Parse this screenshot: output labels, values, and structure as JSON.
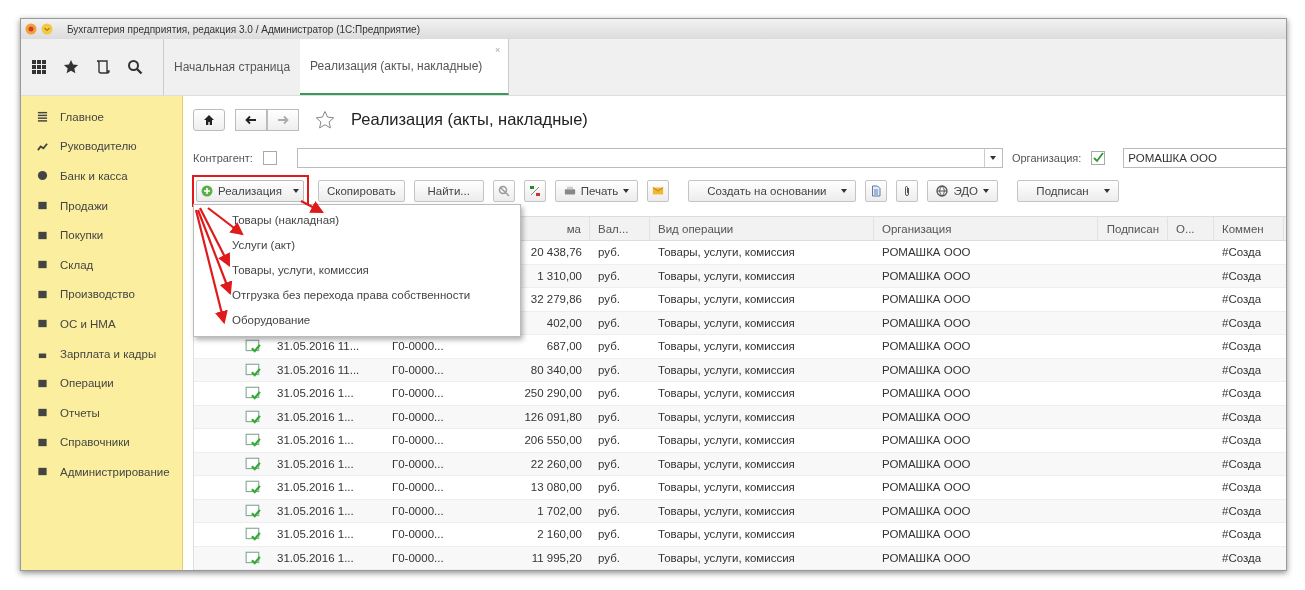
{
  "window": {
    "title": "Бухгалтерия предприятия, редакция 3.0 / Администратор  (1С:Предприятие)"
  },
  "tabs": [
    {
      "label": "Начальная страница",
      "selected": false,
      "closable": false
    },
    {
      "label": "Реализация (акты, накладные)",
      "selected": true,
      "closable": true
    }
  ],
  "tab_close": "×",
  "sidebar": {
    "items": [
      {
        "label": "Главное"
      },
      {
        "label": "Руководителю"
      },
      {
        "label": "Банк и касса"
      },
      {
        "label": "Продажи"
      },
      {
        "label": "Покупки"
      },
      {
        "label": "Склад"
      },
      {
        "label": "Производство"
      },
      {
        "label": "ОС и НМА"
      },
      {
        "label": "Зарплата и кадры"
      },
      {
        "label": "Операции"
      },
      {
        "label": "Отчеты"
      },
      {
        "label": "Справочники"
      },
      {
        "label": "Администрирование"
      }
    ]
  },
  "page": {
    "title": "Реализация (акты, накладные)",
    "favorite": false
  },
  "filters": {
    "counterparty": {
      "label": "Контрагент:",
      "checked": false
    },
    "organization": {
      "label": "Организация:",
      "checked": true,
      "value": "РОМАШКА ООО"
    }
  },
  "toolbar": [
    {
      "kind": "create",
      "label": "Реализация",
      "dropdown": true
    },
    {
      "kind": "text",
      "label": "Скопировать"
    },
    {
      "kind": "text",
      "label": "Найти..."
    },
    {
      "kind": "unfind"
    },
    {
      "kind": "ledger"
    },
    {
      "kind": "print",
      "label": "Печать",
      "dropdown": true
    },
    {
      "kind": "mail"
    },
    {
      "kind": "text",
      "label": "Создать на основании",
      "dropdown": true
    },
    {
      "kind": "report"
    },
    {
      "kind": "attach"
    },
    {
      "kind": "edo",
      "label": "ЭДО",
      "dropdown": true
    },
    {
      "kind": "text",
      "label": "Подписан",
      "dropdown": true
    }
  ],
  "create_menu": {
    "items": [
      "Товары (накладная)",
      "Услуги (акт)",
      "Товары, услуги, комиссия",
      "Отгрузка без перехода права собственности",
      "Оборудование"
    ]
  },
  "table": {
    "columns": [
      {
        "label": "ма"
      },
      {
        "label": "Вал..."
      },
      {
        "label": "Вид операции"
      },
      {
        "label": "Организация"
      },
      {
        "label": "Подписан"
      },
      {
        "label": "О..."
      },
      {
        "label": "Коммен"
      }
    ],
    "rows": [
      {
        "sum": "20 438,76",
        "currency": "руб.",
        "operation": "Товары, услуги, комиссия",
        "organization": "РОМАШКА ООО",
        "comment": "#Созда"
      },
      {
        "sum": "1 310,00",
        "currency": "руб.",
        "operation": "Товары, услуги, комиссия",
        "organization": "РОМАШКА ООО",
        "comment": "#Созда"
      },
      {
        "sum": "32 279,86",
        "currency": "руб.",
        "operation": "Товары, услуги, комиссия",
        "organization": "РОМАШКА ООО",
        "comment": "#Созда"
      },
      {
        "sum": "402,00",
        "currency": "руб.",
        "operation": "Товары, услуги, комиссия",
        "organization": "РОМАШКА ООО",
        "comment": "#Созда"
      },
      {
        "date": "31.05.2016 11...",
        "number": "Г0-0000...",
        "sum": "687,00",
        "currency": "руб.",
        "operation": "Товары, услуги, комиссия",
        "organization": "РОМАШКА ООО",
        "comment": "#Созда"
      },
      {
        "date": "31.05.2016 11...",
        "number": "Г0-0000...",
        "sum": "80 340,00",
        "currency": "руб.",
        "operation": "Товары, услуги, комиссия",
        "organization": "РОМАШКА ООО",
        "comment": "#Созда"
      },
      {
        "date": "31.05.2016 1...",
        "number": "Г0-0000...",
        "sum": "250 290,00",
        "currency": "руб.",
        "operation": "Товары, услуги, комиссия",
        "organization": "РОМАШКА ООО",
        "comment": "#Созда"
      },
      {
        "date": "31.05.2016 1...",
        "number": "Г0-0000...",
        "sum": "126 091,80",
        "currency": "руб.",
        "operation": "Товары, услуги, комиссия",
        "organization": "РОМАШКА ООО",
        "comment": "#Созда"
      },
      {
        "date": "31.05.2016 1...",
        "number": "Г0-0000...",
        "sum": "206 550,00",
        "currency": "руб.",
        "operation": "Товары, услуги, комиссия",
        "organization": "РОМАШКА ООО",
        "comment": "#Созда"
      },
      {
        "date": "31.05.2016 1...",
        "number": "Г0-0000...",
        "sum": "22 260,00",
        "currency": "руб.",
        "operation": "Товары, услуги, комиссия",
        "organization": "РОМАШКА ООО",
        "comment": "#Созда"
      },
      {
        "date": "31.05.2016 1...",
        "number": "Г0-0000...",
        "sum": "13 080,00",
        "currency": "руб.",
        "operation": "Товары, услуги, комиссия",
        "organization": "РОМАШКА ООО",
        "comment": "#Созда"
      },
      {
        "date": "31.05.2016 1...",
        "number": "Г0-0000...",
        "sum": "1 702,00",
        "currency": "руб.",
        "operation": "Товары, услуги, комиссия",
        "organization": "РОМАШКА ООО",
        "comment": "#Созда"
      },
      {
        "date": "31.05.2016 1...",
        "number": "Г0-0000...",
        "sum": "2 160,00",
        "currency": "руб.",
        "operation": "Товары, услуги, комиссия",
        "organization": "РОМАШКА ООО",
        "comment": "#Созда"
      },
      {
        "date": "31.05.2016 1...",
        "number": "Г0-0000...",
        "sum": "11 995,20",
        "currency": "руб.",
        "operation": "Товары, услуги, комиссия",
        "organization": "РОМАШКА ООО",
        "comment": "#Созда"
      }
    ]
  }
}
